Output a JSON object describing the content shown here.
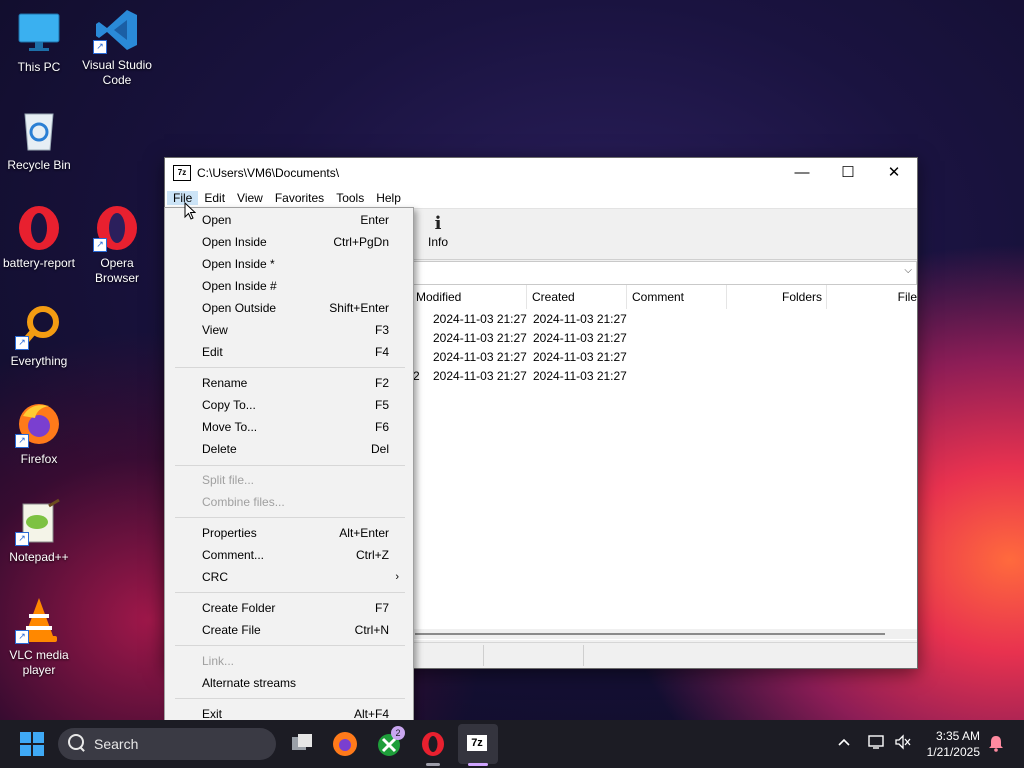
{
  "desktop": {
    "icons": [
      {
        "label": "This PC"
      },
      {
        "label": "Visual Studio Code"
      },
      {
        "label": "Recycle Bin"
      },
      {
        "label": "battery-report"
      },
      {
        "label": "Opera Browser"
      },
      {
        "label": "Everything"
      },
      {
        "label": "Firefox"
      },
      {
        "label": "Notepad++"
      },
      {
        "label": "VLC media player"
      }
    ]
  },
  "window": {
    "app_icon_text": "7z",
    "title": "C:\\Users\\VM6\\Documents\\",
    "controls": {
      "minimize": "—",
      "maximize": "☐",
      "close": "✕"
    },
    "menubar": [
      "File",
      "Edit",
      "View",
      "Favorites",
      "Tools",
      "Help"
    ],
    "toolbar": {
      "info_label": "Info",
      "info_glyph": "i"
    },
    "columns": [
      "Modified",
      "Created",
      "Comment",
      "Folders",
      "File"
    ],
    "rows": [
      {
        "prefix": "",
        "modified": "2024-11-03 21:27",
        "created": "2024-11-03 21:27"
      },
      {
        "prefix": "",
        "modified": "2024-11-03 21:27",
        "created": "2024-11-03 21:27"
      },
      {
        "prefix": "",
        "modified": "2024-11-03 21:27",
        "created": "2024-11-03 21:27"
      },
      {
        "prefix": "2",
        "modified": "2024-11-03 21:27",
        "created": "2024-11-03 21:27"
      }
    ]
  },
  "file_menu": {
    "items": [
      {
        "label": "Open",
        "shortcut": "Enter"
      },
      {
        "label": "Open Inside",
        "shortcut": "Ctrl+PgDn"
      },
      {
        "label": "Open Inside *",
        "shortcut": ""
      },
      {
        "label": "Open Inside #",
        "shortcut": ""
      },
      {
        "label": "Open Outside",
        "shortcut": "Shift+Enter"
      },
      {
        "label": "View",
        "shortcut": "F3"
      },
      {
        "label": "Edit",
        "shortcut": "F4"
      },
      {
        "label": "Rename",
        "shortcut": "F2"
      },
      {
        "label": "Copy To...",
        "shortcut": "F5"
      },
      {
        "label": "Move To...",
        "shortcut": "F6"
      },
      {
        "label": "Delete",
        "shortcut": "Del"
      },
      {
        "label": "Split file...",
        "shortcut": ""
      },
      {
        "label": "Combine files...",
        "shortcut": ""
      },
      {
        "label": "Properties",
        "shortcut": "Alt+Enter"
      },
      {
        "label": "Comment...",
        "shortcut": "Ctrl+Z"
      },
      {
        "label": "CRC",
        "shortcut": "›"
      },
      {
        "label": "Create Folder",
        "shortcut": "F7"
      },
      {
        "label": "Create File",
        "shortcut": "Ctrl+N"
      },
      {
        "label": "Link...",
        "shortcut": ""
      },
      {
        "label": "Alternate streams",
        "shortcut": ""
      },
      {
        "label": "Exit",
        "shortcut": "Alt+F4"
      }
    ]
  },
  "taskbar": {
    "search_label": "Search",
    "xbox_badge": "2",
    "sevenzip_label": "7z",
    "time": "3:35 AM",
    "date": "1/21/2025"
  },
  "colors": {
    "accent": "#3fa9f5",
    "menu_highlight": "#cce4f7",
    "taskbar": "#1c1c24"
  }
}
